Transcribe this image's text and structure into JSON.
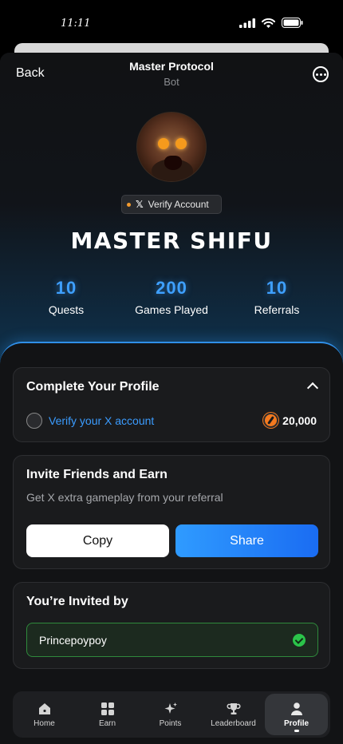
{
  "status_bar": {
    "time": "11:11"
  },
  "nav": {
    "back_label": "Back",
    "title": "Master Protocol",
    "subtitle": "Bot"
  },
  "profile": {
    "verify_label": "Verify Account",
    "x_glyph": "𝕏",
    "username": "MASTER SHIFU",
    "stats": [
      {
        "value": "10",
        "label": "Quests"
      },
      {
        "value": "200",
        "label": "Games Played"
      },
      {
        "value": "10",
        "label": "Referrals"
      }
    ]
  },
  "complete_profile": {
    "title": "Complete Your Profile",
    "task_label": "Verify your X account",
    "reward": "20,000"
  },
  "invite": {
    "title": "Invite Friends and Earn",
    "subtitle": "Get X extra gameplay from your referral",
    "copy_label": "Copy",
    "share_label": "Share"
  },
  "invited_by": {
    "title": "You’re Invited by",
    "name": "Princepoypoy"
  },
  "tabbar": {
    "items": [
      {
        "label": "Home",
        "icon": "home-icon"
      },
      {
        "label": "Earn",
        "icon": "grid-icon"
      },
      {
        "label": "Points",
        "icon": "sparkle-icon"
      },
      {
        "label": "Leaderboard",
        "icon": "trophy-icon"
      },
      {
        "label": "Profile",
        "icon": "person-icon",
        "active": true
      }
    ]
  },
  "colors": {
    "accent": "#3b9cff",
    "success": "#2bc44a",
    "coin": "#f47a1f"
  }
}
